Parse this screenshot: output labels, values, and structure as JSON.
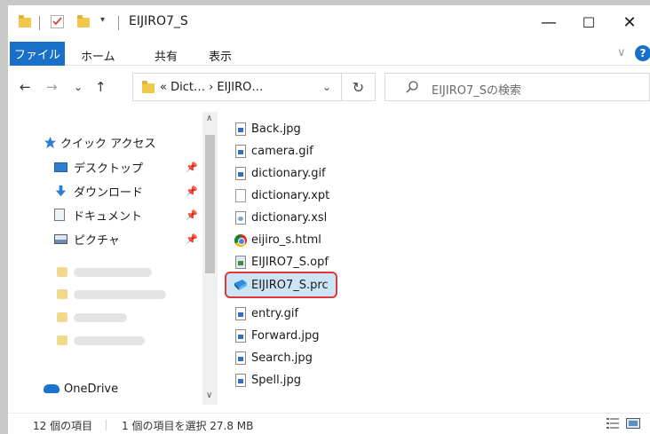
{
  "window": {
    "title": "EIJIRO7_S",
    "minimize_glyph": "—",
    "maximize_glyph": "☐",
    "close_glyph": "✕"
  },
  "ribbon": {
    "tabs": [
      "ファイル",
      "ホーム",
      "共有",
      "表示"
    ],
    "collapse_glyph": "∨",
    "help_glyph": "?"
  },
  "address": {
    "path": "« Dict… › EIJIRO…",
    "back_glyph": "←",
    "forward_glyph": "→",
    "recent_glyph": "⌄",
    "up_glyph": "↑",
    "dropdown_glyph": "⌄",
    "refresh_glyph": "↻",
    "search_placeholder": "EIJIRO7_Sの検索"
  },
  "nav": {
    "quick_access": "クイック アクセス",
    "items": [
      {
        "label": "デスクトップ",
        "icon": "desktop-icon"
      },
      {
        "label": "ダウンロード",
        "icon": "download-icon"
      },
      {
        "label": "ドキュメント",
        "icon": "document-icon"
      },
      {
        "label": "ピクチャ",
        "icon": "pictures-icon"
      }
    ],
    "pin_glyph": "📌",
    "onedrive": "OneDrive"
  },
  "files": [
    {
      "name": "Back.jpg",
      "icon": "image-file-icon"
    },
    {
      "name": "camera.gif",
      "icon": "image-file-icon"
    },
    {
      "name": "dictionary.gif",
      "icon": "image-file-icon"
    },
    {
      "name": "dictionary.xpt",
      "icon": "blank-file-icon"
    },
    {
      "name": "dictionary.xsl",
      "icon": "xsl-file-icon"
    },
    {
      "name": "eijiro_s.html",
      "icon": "chrome-icon"
    },
    {
      "name": "EIJIRO7_S.opf",
      "icon": "opf-file-icon"
    },
    {
      "name": "EIJIRO7_S.prc",
      "icon": "kindle-book-icon",
      "selected": true
    },
    {
      "name": "entry.gif",
      "icon": "image-file-icon"
    },
    {
      "name": "Forward.jpg",
      "icon": "image-file-icon"
    },
    {
      "name": "Search.jpg",
      "icon": "image-file-icon"
    },
    {
      "name": "Spell.jpg",
      "icon": "image-file-icon"
    }
  ],
  "status": {
    "item_count": "12 個の項目",
    "selection": "1 個の項目を選択  27.8 MB"
  },
  "colors": {
    "accent": "#1a6fc8",
    "selection_bg": "#cde4f7",
    "highlight_border": "#e0373b"
  }
}
